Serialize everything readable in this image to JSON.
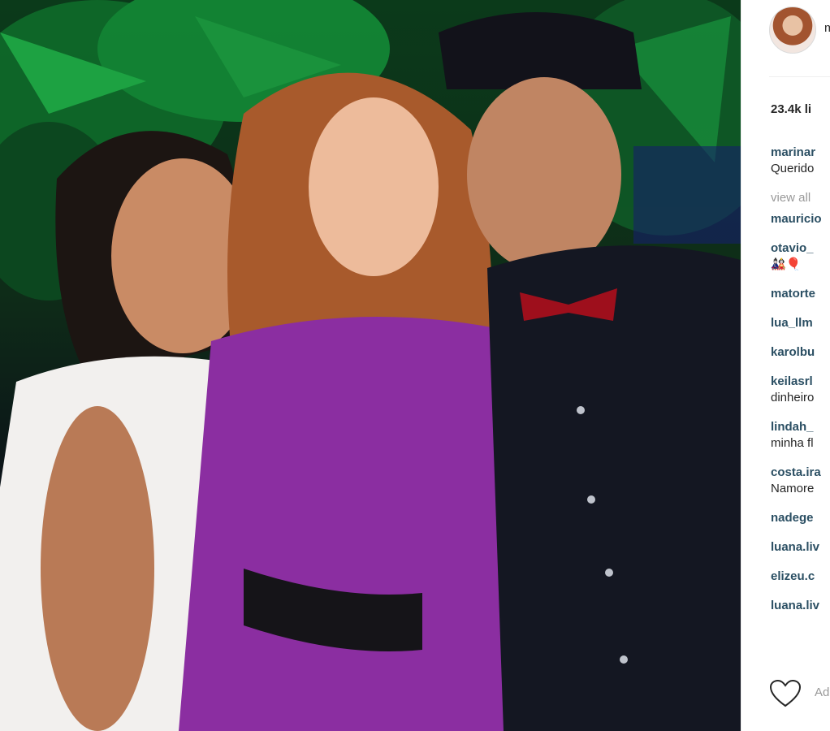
{
  "post": {
    "image_description": "",
    "owner": {
      "name": "m"
    },
    "likes": "23.4k li",
    "comments": [
      {
        "user": "marinar",
        "text": "Querido"
      },
      {
        "user": "mauricio",
        "text": ""
      },
      {
        "user": "otavio_",
        "text": "🎎🎈"
      },
      {
        "user": "matorte",
        "text": ""
      },
      {
        "user": "lua_llm",
        "text": ""
      },
      {
        "user": "karolbu",
        "text": ""
      },
      {
        "user": "keilasrl",
        "text": "dinheiro"
      },
      {
        "user": "lindah_",
        "text": "minha fl"
      },
      {
        "user": "costa.ira",
        "text": "Namore"
      },
      {
        "user": "nadege",
        "text": ""
      },
      {
        "user": "luana.liv",
        "text": ""
      },
      {
        "user": "elizeu.c",
        "text": ""
      },
      {
        "user": "luana.liv",
        "text": ""
      }
    ],
    "view_all": "view all",
    "add_comment_placeholder": "Ad",
    "icons": {
      "like": "heart-icon"
    },
    "colors": {
      "username": "#2b4f63",
      "text": "#262626",
      "muted": "#999999"
    }
  }
}
